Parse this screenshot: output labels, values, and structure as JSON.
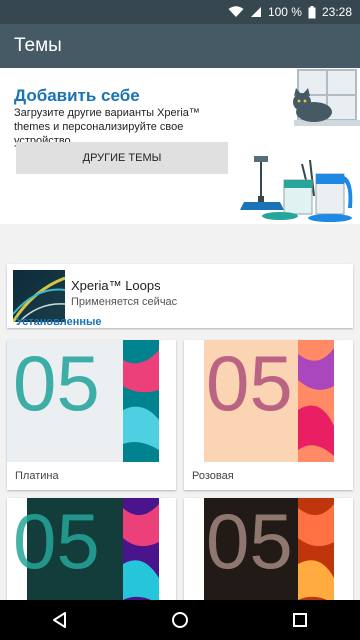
{
  "status_bar": {
    "battery_percent": "100 %",
    "time": "23:28"
  },
  "app_bar": {
    "title": "Темы"
  },
  "promo": {
    "title": "Добавить себе",
    "description": "Загрузите другие варианты Xperia™ themes и персонализируйте свое устройство",
    "button_label": "ДРУГИЕ ТЕМЫ"
  },
  "current_theme": {
    "name": "Xperia™ Loops",
    "status": "Применяется сейчас"
  },
  "installed": {
    "section_title": "Установленные",
    "themes": [
      {
        "label": "Платина"
      },
      {
        "label": "Розовая"
      },
      {
        "label": ""
      },
      {
        "label": ""
      }
    ]
  },
  "colors": {
    "accent": "#1a73b5",
    "app_bar": "#455a64",
    "status_bar": "#37474f"
  }
}
